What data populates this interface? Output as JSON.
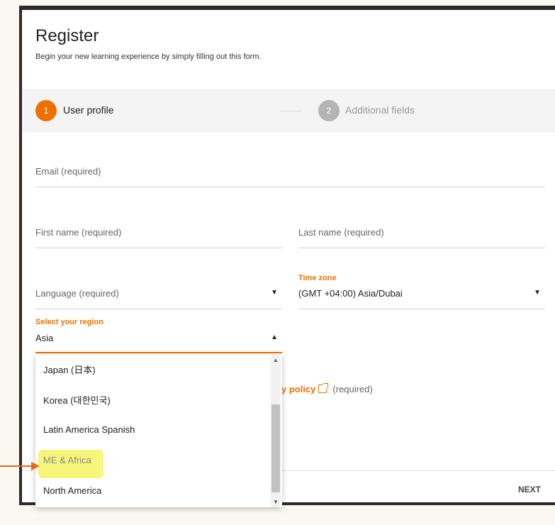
{
  "page": {
    "title": "Register",
    "subtitle": "Begin your new learning experience by simply filling out this form."
  },
  "steps": [
    {
      "number": "1",
      "label": "User profile",
      "active": true
    },
    {
      "number": "2",
      "label": "Additional fields",
      "active": false
    }
  ],
  "form": {
    "email_placeholder": "Email  (required)",
    "first_name_placeholder": "First name  (required)",
    "last_name_placeholder": "Last name  (required)",
    "language_placeholder": "Language (required)",
    "timezone_label": "Time zone",
    "timezone_value": "(GMT +04:00) Asia/Dubai",
    "region_label": "Select your region",
    "region_value": "Asia"
  },
  "region_options": [
    "Japan (日本)",
    "Korea (대한민국)",
    "Latin America Spanish",
    "ME & Africa",
    "North America"
  ],
  "privacy": {
    "link_text": "y policy",
    "required_text": "(required)"
  },
  "footer": {
    "next_label": "NEXT"
  },
  "colors": {
    "accent": "#ee7100",
    "highlight": "#f6f56d",
    "annotation_arrow": "#e36b18"
  }
}
